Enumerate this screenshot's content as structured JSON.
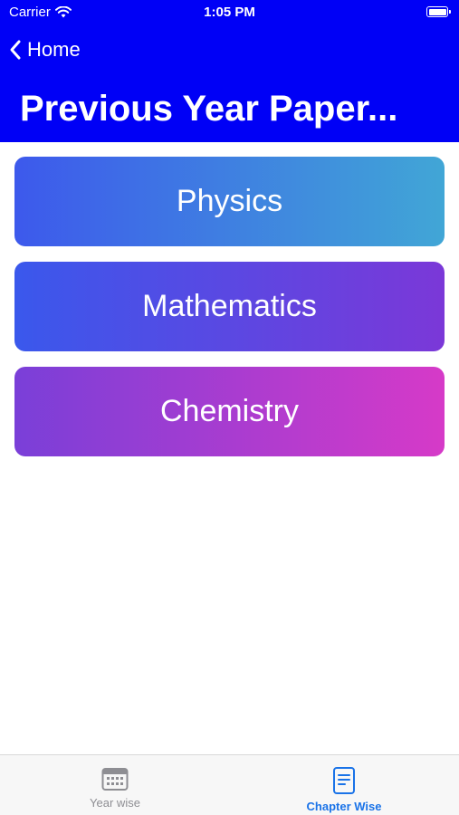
{
  "status_bar": {
    "carrier": "Carrier",
    "time": "1:05 PM"
  },
  "nav": {
    "back_label": "Home",
    "title": "Previous Year Paper..."
  },
  "subjects": [
    {
      "label": "Physics"
    },
    {
      "label": "Mathematics"
    },
    {
      "label": "Chemistry"
    }
  ],
  "tabs": [
    {
      "label": "Year wise",
      "icon": "calendar-icon",
      "active": false
    },
    {
      "label": "Chapter Wise",
      "icon": "document-icon",
      "active": true
    }
  ],
  "colors": {
    "header": "#0000f6",
    "active_tab": "#1a73e8",
    "inactive_tab": "#8e8e93"
  }
}
